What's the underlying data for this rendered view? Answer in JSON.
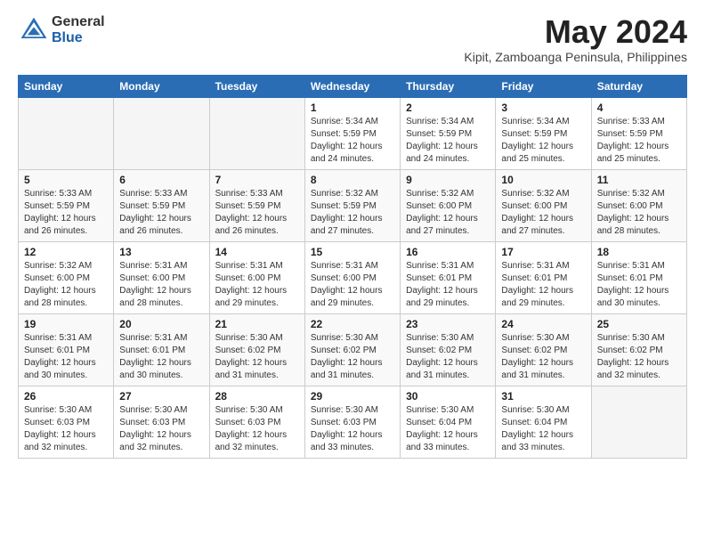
{
  "logo": {
    "general": "General",
    "blue": "Blue"
  },
  "title": "May 2024",
  "location": "Kipit, Zamboanga Peninsula, Philippines",
  "days_of_week": [
    "Sunday",
    "Monday",
    "Tuesday",
    "Wednesday",
    "Thursday",
    "Friday",
    "Saturday"
  ],
  "weeks": [
    [
      {
        "day": "",
        "info": ""
      },
      {
        "day": "",
        "info": ""
      },
      {
        "day": "",
        "info": ""
      },
      {
        "day": "1",
        "info": "Sunrise: 5:34 AM\nSunset: 5:59 PM\nDaylight: 12 hours\nand 24 minutes."
      },
      {
        "day": "2",
        "info": "Sunrise: 5:34 AM\nSunset: 5:59 PM\nDaylight: 12 hours\nand 24 minutes."
      },
      {
        "day": "3",
        "info": "Sunrise: 5:34 AM\nSunset: 5:59 PM\nDaylight: 12 hours\nand 25 minutes."
      },
      {
        "day": "4",
        "info": "Sunrise: 5:33 AM\nSunset: 5:59 PM\nDaylight: 12 hours\nand 25 minutes."
      }
    ],
    [
      {
        "day": "5",
        "info": "Sunrise: 5:33 AM\nSunset: 5:59 PM\nDaylight: 12 hours\nand 26 minutes."
      },
      {
        "day": "6",
        "info": "Sunrise: 5:33 AM\nSunset: 5:59 PM\nDaylight: 12 hours\nand 26 minutes."
      },
      {
        "day": "7",
        "info": "Sunrise: 5:33 AM\nSunset: 5:59 PM\nDaylight: 12 hours\nand 26 minutes."
      },
      {
        "day": "8",
        "info": "Sunrise: 5:32 AM\nSunset: 5:59 PM\nDaylight: 12 hours\nand 27 minutes."
      },
      {
        "day": "9",
        "info": "Sunrise: 5:32 AM\nSunset: 6:00 PM\nDaylight: 12 hours\nand 27 minutes."
      },
      {
        "day": "10",
        "info": "Sunrise: 5:32 AM\nSunset: 6:00 PM\nDaylight: 12 hours\nand 27 minutes."
      },
      {
        "day": "11",
        "info": "Sunrise: 5:32 AM\nSunset: 6:00 PM\nDaylight: 12 hours\nand 28 minutes."
      }
    ],
    [
      {
        "day": "12",
        "info": "Sunrise: 5:32 AM\nSunset: 6:00 PM\nDaylight: 12 hours\nand 28 minutes."
      },
      {
        "day": "13",
        "info": "Sunrise: 5:31 AM\nSunset: 6:00 PM\nDaylight: 12 hours\nand 28 minutes."
      },
      {
        "day": "14",
        "info": "Sunrise: 5:31 AM\nSunset: 6:00 PM\nDaylight: 12 hours\nand 29 minutes."
      },
      {
        "day": "15",
        "info": "Sunrise: 5:31 AM\nSunset: 6:00 PM\nDaylight: 12 hours\nand 29 minutes."
      },
      {
        "day": "16",
        "info": "Sunrise: 5:31 AM\nSunset: 6:01 PM\nDaylight: 12 hours\nand 29 minutes."
      },
      {
        "day": "17",
        "info": "Sunrise: 5:31 AM\nSunset: 6:01 PM\nDaylight: 12 hours\nand 29 minutes."
      },
      {
        "day": "18",
        "info": "Sunrise: 5:31 AM\nSunset: 6:01 PM\nDaylight: 12 hours\nand 30 minutes."
      }
    ],
    [
      {
        "day": "19",
        "info": "Sunrise: 5:31 AM\nSunset: 6:01 PM\nDaylight: 12 hours\nand 30 minutes."
      },
      {
        "day": "20",
        "info": "Sunrise: 5:31 AM\nSunset: 6:01 PM\nDaylight: 12 hours\nand 30 minutes."
      },
      {
        "day": "21",
        "info": "Sunrise: 5:30 AM\nSunset: 6:02 PM\nDaylight: 12 hours\nand 31 minutes."
      },
      {
        "day": "22",
        "info": "Sunrise: 5:30 AM\nSunset: 6:02 PM\nDaylight: 12 hours\nand 31 minutes."
      },
      {
        "day": "23",
        "info": "Sunrise: 5:30 AM\nSunset: 6:02 PM\nDaylight: 12 hours\nand 31 minutes."
      },
      {
        "day": "24",
        "info": "Sunrise: 5:30 AM\nSunset: 6:02 PM\nDaylight: 12 hours\nand 31 minutes."
      },
      {
        "day": "25",
        "info": "Sunrise: 5:30 AM\nSunset: 6:02 PM\nDaylight: 12 hours\nand 32 minutes."
      }
    ],
    [
      {
        "day": "26",
        "info": "Sunrise: 5:30 AM\nSunset: 6:03 PM\nDaylight: 12 hours\nand 32 minutes."
      },
      {
        "day": "27",
        "info": "Sunrise: 5:30 AM\nSunset: 6:03 PM\nDaylight: 12 hours\nand 32 minutes."
      },
      {
        "day": "28",
        "info": "Sunrise: 5:30 AM\nSunset: 6:03 PM\nDaylight: 12 hours\nand 32 minutes."
      },
      {
        "day": "29",
        "info": "Sunrise: 5:30 AM\nSunset: 6:03 PM\nDaylight: 12 hours\nand 33 minutes."
      },
      {
        "day": "30",
        "info": "Sunrise: 5:30 AM\nSunset: 6:04 PM\nDaylight: 12 hours\nand 33 minutes."
      },
      {
        "day": "31",
        "info": "Sunrise: 5:30 AM\nSunset: 6:04 PM\nDaylight: 12 hours\nand 33 minutes."
      },
      {
        "day": "",
        "info": ""
      }
    ]
  ]
}
